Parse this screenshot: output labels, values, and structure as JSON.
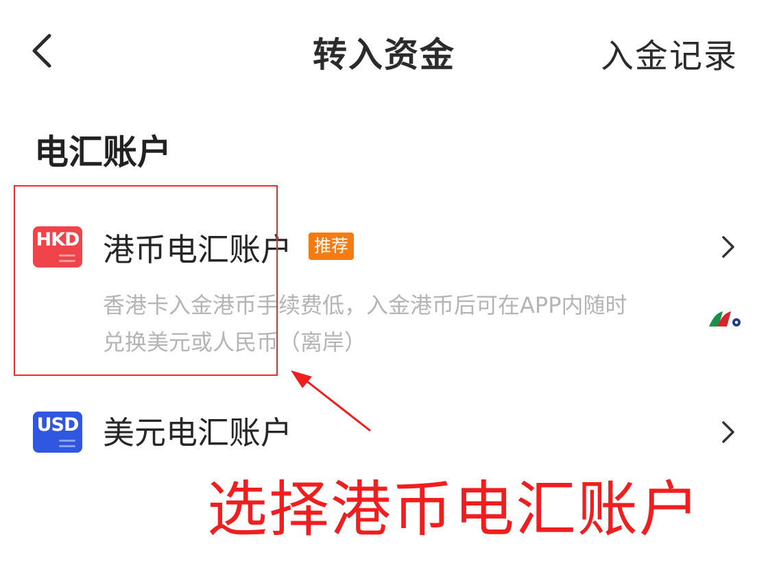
{
  "header": {
    "title": "转入资金",
    "records_link": "入金记录",
    "back_icon": "chevron-left-icon"
  },
  "section": {
    "title": "电汇账户"
  },
  "accounts": [
    {
      "currency_code": "HKD",
      "label": "港币电汇账户",
      "badge": "推荐",
      "description_line1": "香港卡入金港币手续费低，入金港币后可在APP内随时",
      "description_line2": "兑换美元或人民币（离岸）",
      "icon_color": "#f0444b",
      "badge_color": "#f57c12"
    },
    {
      "currency_code": "USD",
      "label": "美元电汇账户",
      "icon_color": "#2f57e0"
    }
  ],
  "annotation": {
    "text": "选择港币电汇账户",
    "color": "#f01e1e"
  },
  "icons": {
    "row_chevron": "chevron-right-icon",
    "watermark": "brand-logo-icon"
  }
}
